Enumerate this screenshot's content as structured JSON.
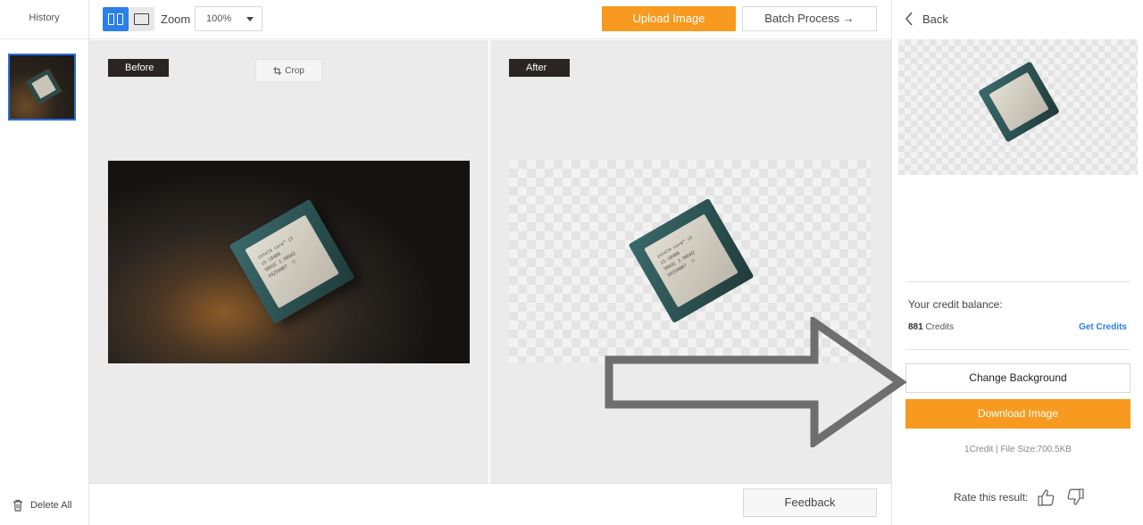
{
  "history": {
    "title": "History",
    "delete_all_label": "Delete All"
  },
  "toolbar": {
    "zoom_label": "Zoom",
    "zoom_value": "100%",
    "upload_label": "Upload Image",
    "batch_label": "Batch Process →"
  },
  "before_pane": {
    "tag": "Before",
    "crop_label": "Crop"
  },
  "after_pane": {
    "tag": "After"
  },
  "chip_label_lines": "intel® core™ i5\ni5-10400\nSRH3C 2.90GHZ\nX925H007  ⓔ",
  "bottombar": {
    "feedback_label": "Feedback"
  },
  "right_panel": {
    "back_label": "Back",
    "credit_title": "Your credit balance:",
    "credit_number": "881",
    "credit_unit": " Credits",
    "get_credits_label": "Get Credits",
    "change_background_label": "Change Background",
    "download_label": "Download Image",
    "file_info": "1Credit | File Size:700.5KB",
    "rate_label": "Rate this result:"
  },
  "colors": {
    "accent_orange": "#f79a1f",
    "accent_blue": "#2a7fe8",
    "overlay_arrow": "#6e6e6e"
  },
  "icons": [
    "trash-icon",
    "split-view-icon",
    "single-view-icon",
    "chevron-down-icon",
    "crop-icon",
    "chevron-left-icon",
    "thumbs-up-icon",
    "thumbs-down-icon",
    "arrow-right-icon"
  ]
}
